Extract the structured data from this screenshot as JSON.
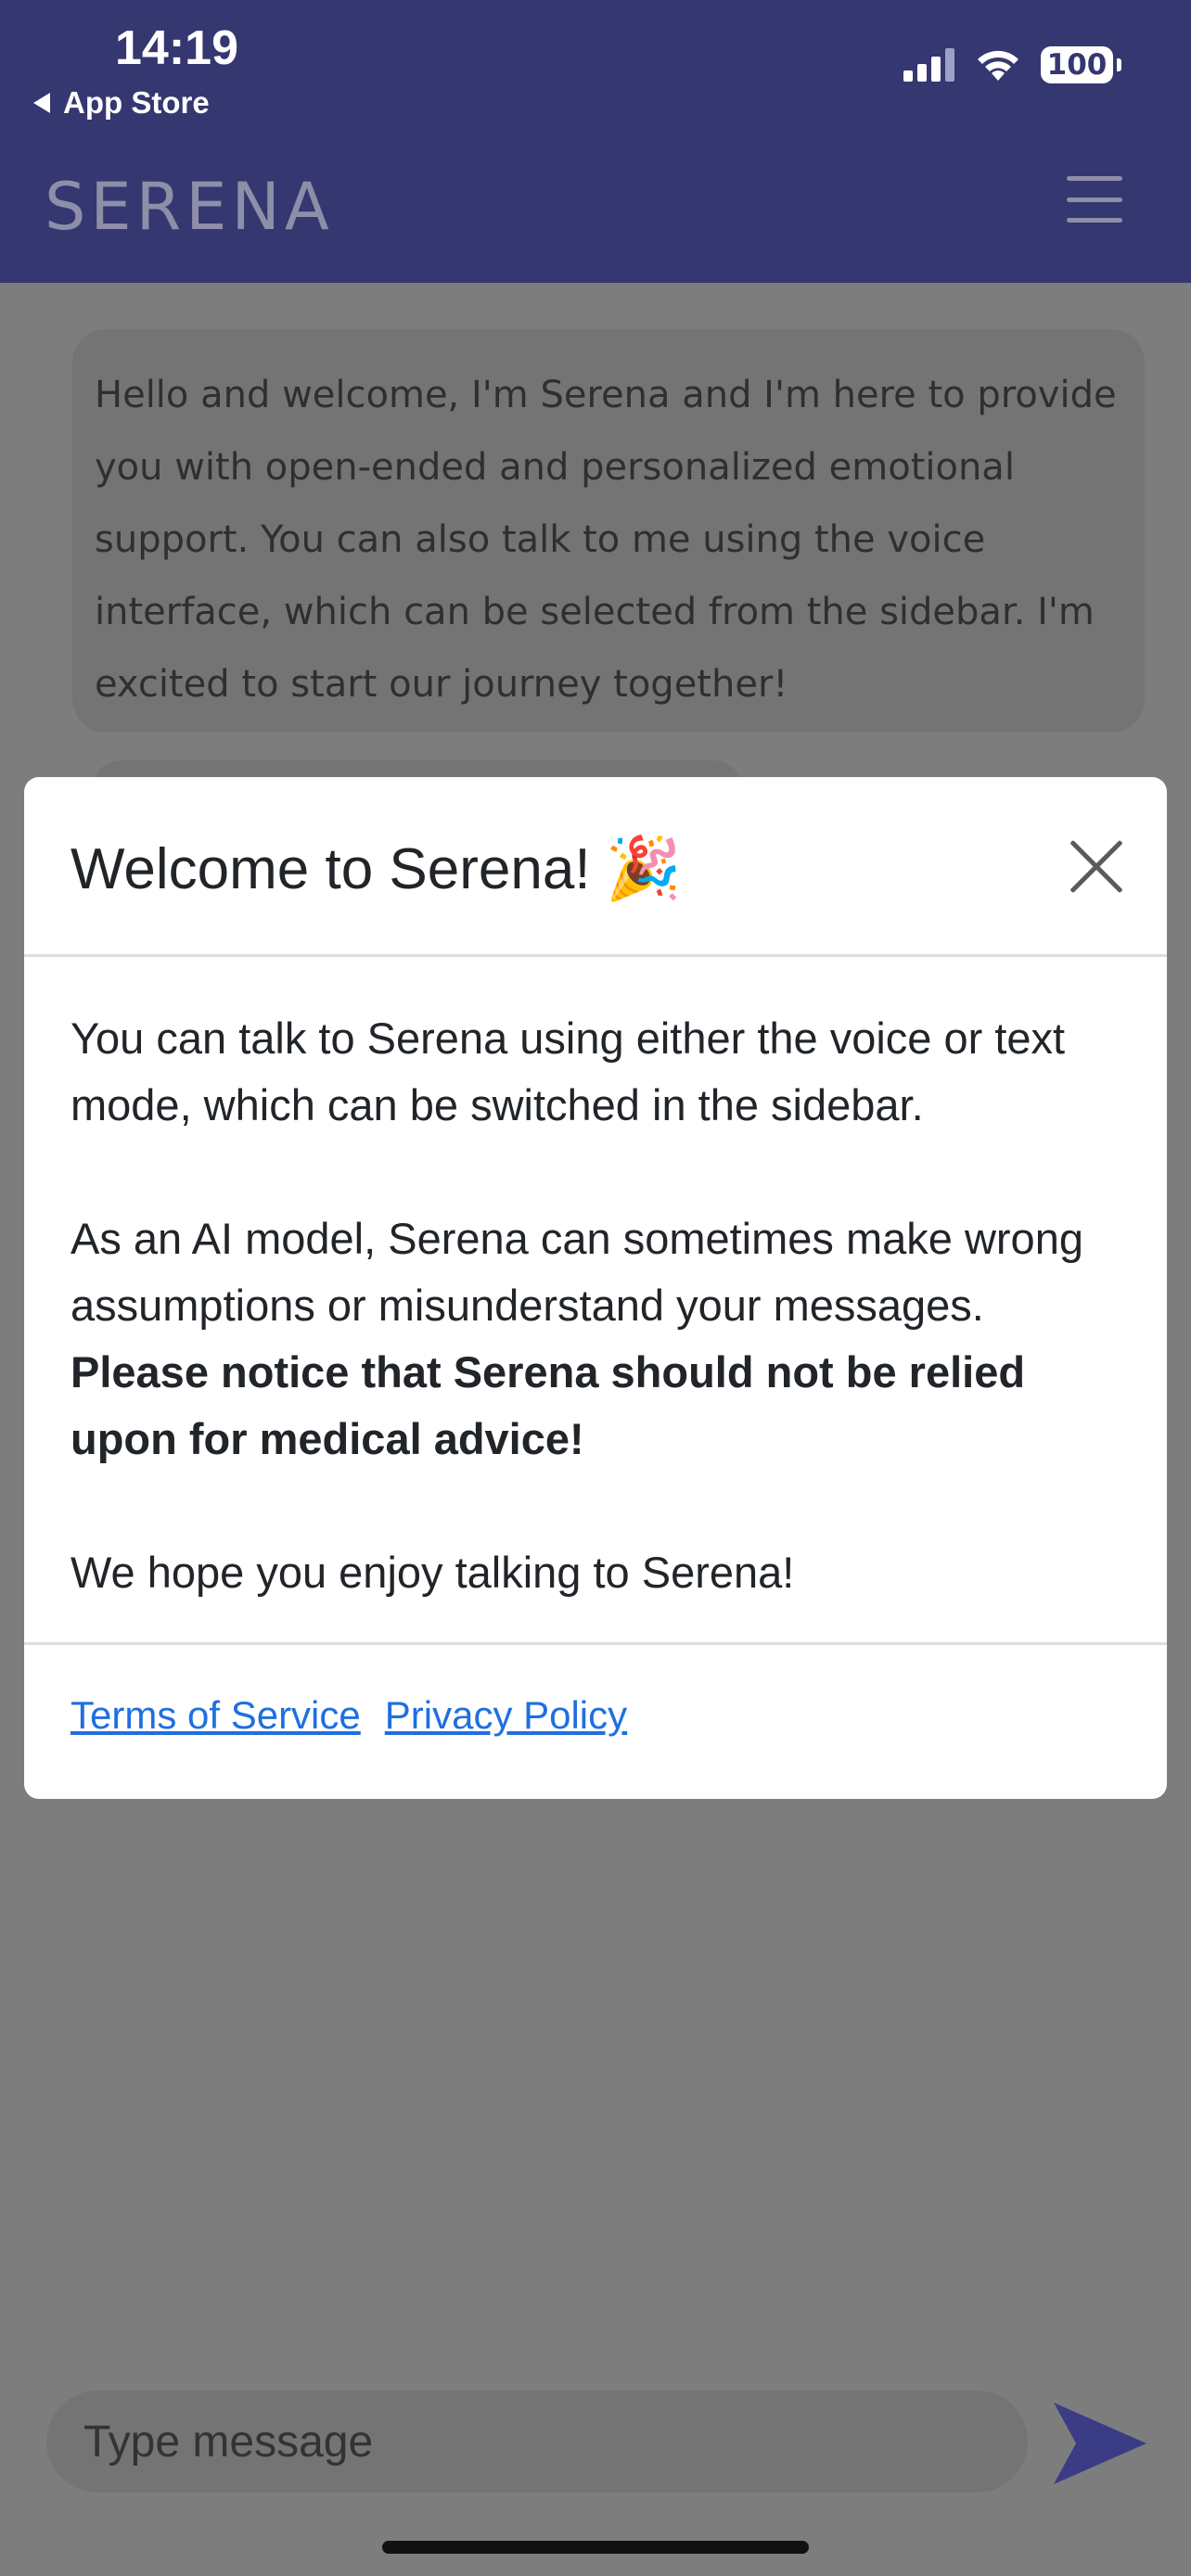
{
  "status": {
    "time": "14:19",
    "back_label": "App Store",
    "battery": "100"
  },
  "header": {
    "brand": "SERENA"
  },
  "chat": {
    "welcome_message": "Hello and welcome, I'm Serena and I'm here to provide you with open-ended and personalized emotional support. You can also talk to me using the voice interface, which can be selected from the sidebar. I'm excited to start our journey together!"
  },
  "modal": {
    "title": "Welcome to Serena!",
    "title_emoji": "🎉",
    "paragraph1": "You can talk to Serena using either the voice or text mode, which can be switched in the sidebar.",
    "paragraph2": "As an AI model, Serena can sometimes make wrong assumptions or misunderstand your messages.",
    "paragraph2_bold": "Please notice that Serena should not be relied upon for medical advice!",
    "paragraph3": "We hope you enjoy talking to Serena!",
    "terms_link": "Terms of Service",
    "privacy_link": "Privacy Policy"
  },
  "composer": {
    "placeholder": "Type message"
  },
  "colors": {
    "header_bg": "#353770",
    "link": "#1f6fe0",
    "send_icon": "#3a3c86"
  },
  "icons": {
    "back": "back-triangle-icon",
    "signal": "cellular-signal-icon",
    "wifi": "wifi-icon",
    "battery": "battery-icon",
    "menu": "hamburger-menu-icon",
    "close": "close-icon",
    "send": "send-icon"
  }
}
